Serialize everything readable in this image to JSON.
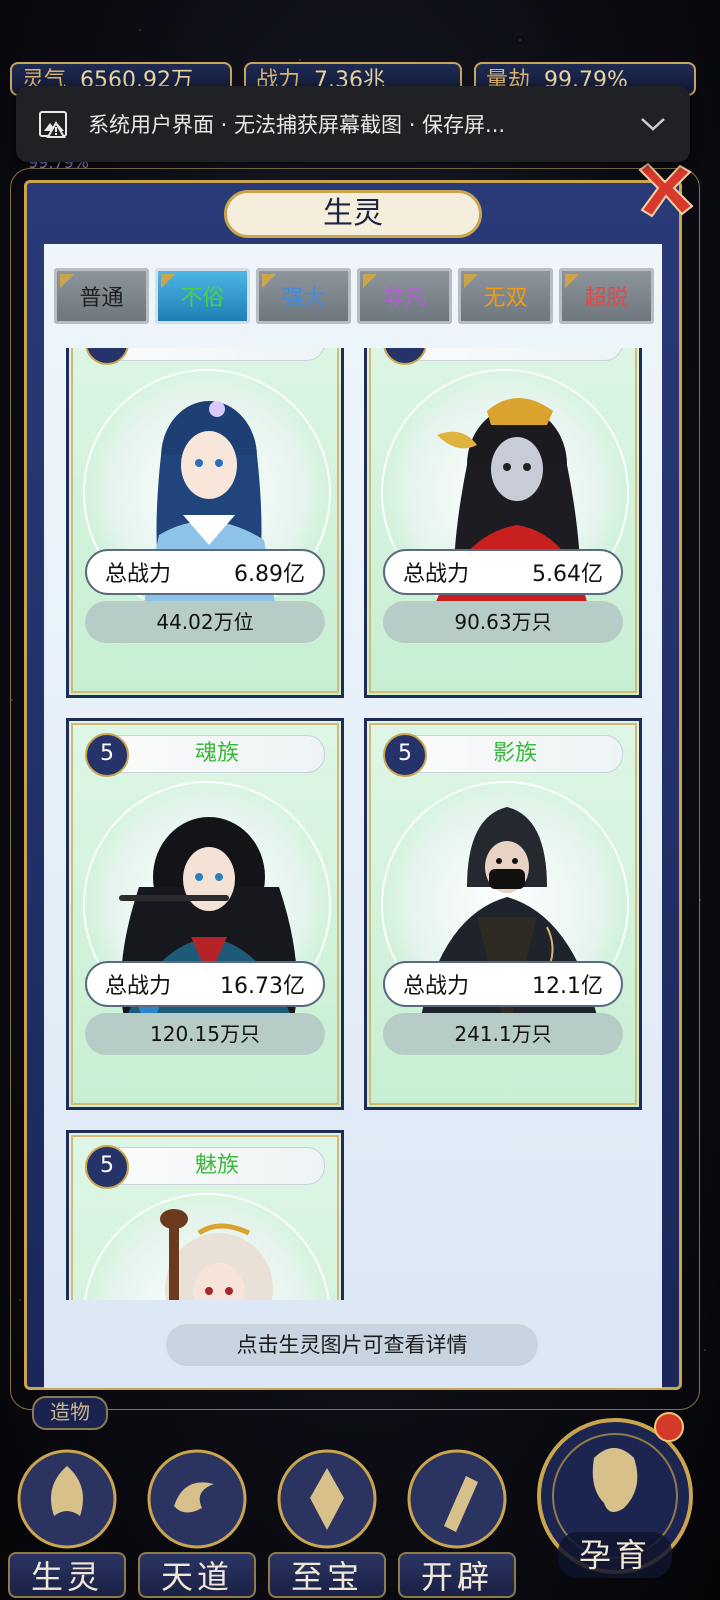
{
  "resources": [
    {
      "key": "灵气",
      "value": "6560.92万"
    },
    {
      "key": "战力",
      "value": "7.36兆"
    },
    {
      "key": "量劫",
      "value": "99.79%"
    }
  ],
  "small_pct": "99.79%",
  "notification": {
    "text": "系统用户界面 · 无法捕获屏幕截图 · 保存屏..."
  },
  "panel": {
    "title": "生灵"
  },
  "tabs": [
    "普通",
    "不俗",
    "强大",
    "非凡",
    "无双",
    "超脱"
  ],
  "cards": [
    {
      "level": "",
      "name": "",
      "power_label": "总战力",
      "power": "6.89亿",
      "count": "44.02万位"
    },
    {
      "level": "",
      "name": "",
      "power_label": "总战力",
      "power": "5.64亿",
      "count": "90.63万只"
    },
    {
      "level": "5",
      "name": "魂族",
      "power_label": "总战力",
      "power": "16.73亿",
      "count": "120.15万只"
    },
    {
      "level": "5",
      "name": "影族",
      "power_label": "总战力",
      "power": "12.1亿",
      "count": "241.1万只"
    },
    {
      "level": "5",
      "name": "魅族",
      "power_label": "",
      "power": "",
      "count": ""
    }
  ],
  "hint": "点击生灵图片可查看详情",
  "bottom_nav": {
    "zaowu": "造物",
    "items": [
      "生灵",
      "天道",
      "至宝",
      "开辟"
    ],
    "yunyu": "孕育"
  },
  "colors": {
    "gold": "#c9a64e",
    "navy": "#1f2c55",
    "accent_green": "#39b93a"
  }
}
